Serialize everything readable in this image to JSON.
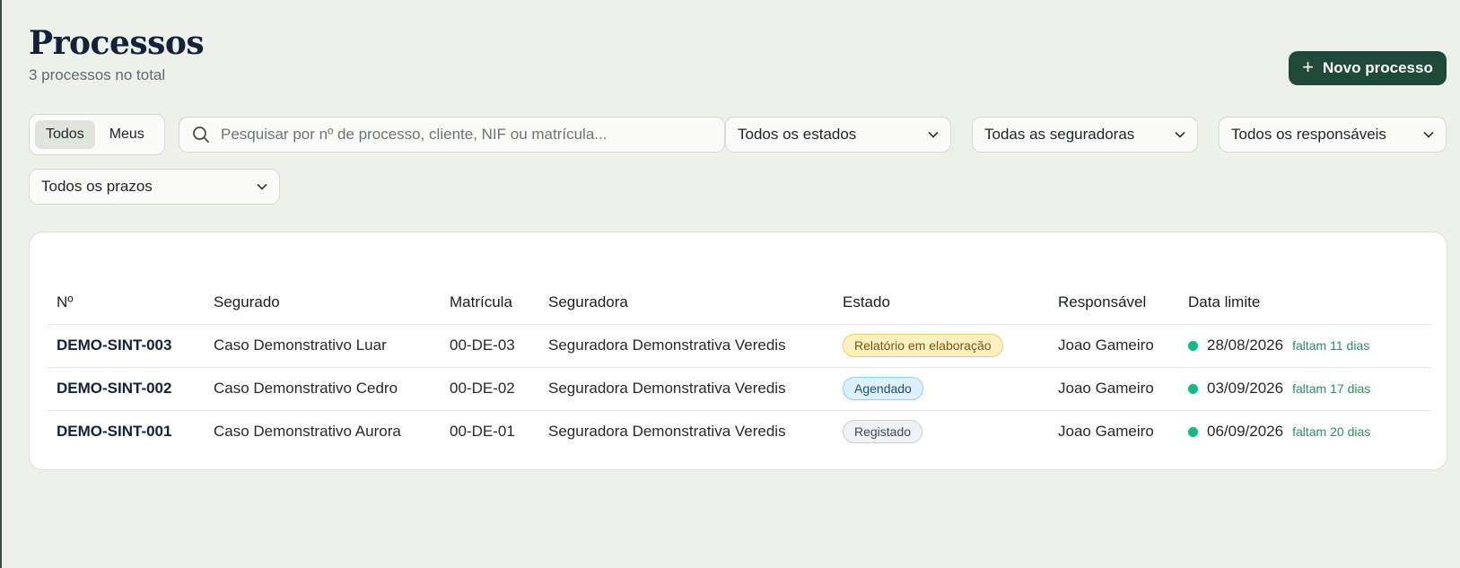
{
  "header": {
    "title": "Processos",
    "subtitle": "3 processos no total",
    "new_button": "Novo processo"
  },
  "filters": {
    "scope": [
      "Todos",
      "Meus"
    ],
    "scope_selected": "Todos",
    "search_placeholder": "Pesquisar por nº de processo, cliente, NIF ou matrícula...",
    "estado": "Todos os estados",
    "seguradora": "Todas as seguradoras",
    "responsavel": "Todos os responsáveis",
    "prazo": "Todos os prazos"
  },
  "table": {
    "columns": [
      "Nº",
      "Segurado",
      "Matrícula",
      "Seguradora",
      "Estado",
      "Responsável",
      "Data limite"
    ],
    "rows": [
      {
        "numero": "DEMO-SINT-003",
        "segurado": "Caso Demonstrativo Luar",
        "matricula": "00-DE-03",
        "seguradora": "Seguradora Demonstrativa Veredis",
        "estado": "Relatório em elaboração",
        "responsavel": "Joao Gameiro",
        "data_limite": "28/08/2026",
        "faltam": "faltam 11 dias"
      },
      {
        "numero": "DEMO-SINT-002",
        "segurado": "Caso Demonstrativo Cedro",
        "matricula": "00-DE-02",
        "seguradora": "Seguradora Demonstrativa Veredis",
        "estado": "Agendado",
        "responsavel": "Joao Gameiro",
        "data_limite": "03/09/2026",
        "faltam": "faltam 17 dias"
      },
      {
        "numero": "DEMO-SINT-001",
        "segurado": "Caso Demonstrativo Aurora",
        "matricula": "00-DE-01",
        "seguradora": "Seguradora Demonstrativa Veredis",
        "estado": "Registado",
        "responsavel": "Joao Gameiro",
        "data_limite": "06/09/2026",
        "faltam": "faltam 20 dias"
      }
    ]
  },
  "colors": {
    "primary": "#1f4a3a",
    "background": "#eef0ea",
    "deadline_ok": "#12b886",
    "deadline_text": "#2f8f5f"
  },
  "icons": {
    "search": "search-icon",
    "plus": "plus-icon",
    "chevron": "chevron-down-icon",
    "status_dot": "status-dot-icon"
  }
}
